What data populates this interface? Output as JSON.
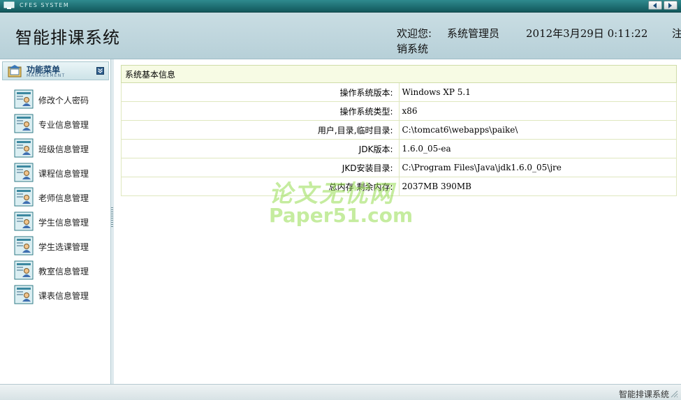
{
  "topbar": {
    "system_name": "CFES SYSTEM"
  },
  "header": {
    "app_title": "智能排课系统",
    "welcome_label": "欢迎您:",
    "username": "系统管理员",
    "datetime": "2012年3月29日  0:11:22",
    "logout_part1": "注",
    "logout_part2": "销系统"
  },
  "sidebar": {
    "menu_title": "功能菜单",
    "menu_subtitle": "MANAGEMENT",
    "items": [
      {
        "label": "修改个人密码"
      },
      {
        "label": "专业信息管理"
      },
      {
        "label": "班级信息管理"
      },
      {
        "label": "课程信息管理"
      },
      {
        "label": "老师信息管理"
      },
      {
        "label": "学生信息管理"
      },
      {
        "label": "学生选课管理"
      },
      {
        "label": "教室信息管理"
      },
      {
        "label": "课表信息管理"
      }
    ]
  },
  "main": {
    "table_title": "系统基本信息",
    "rows": [
      {
        "label": "操作系统版本:",
        "value": "Windows XP  5.1"
      },
      {
        "label": "操作系统类型:",
        "value": "x86"
      },
      {
        "label": "用户,目录,临时目录:",
        "value": "C:\\tomcat6\\webapps\\paike\\"
      },
      {
        "label": "JDK版本:",
        "value": "1.6.0_05-ea"
      },
      {
        "label": "JKD安装目录:",
        "value": "C:\\Program Files\\Java\\jdk1.6.0_05\\jre"
      },
      {
        "label": "总内存 剩余内存:",
        "value": "2037MB   390MB"
      }
    ]
  },
  "watermark": {
    "cn": "论文无忧网",
    "en": "Paper51.com"
  },
  "statusbar": {
    "text": "智能排课系统"
  }
}
